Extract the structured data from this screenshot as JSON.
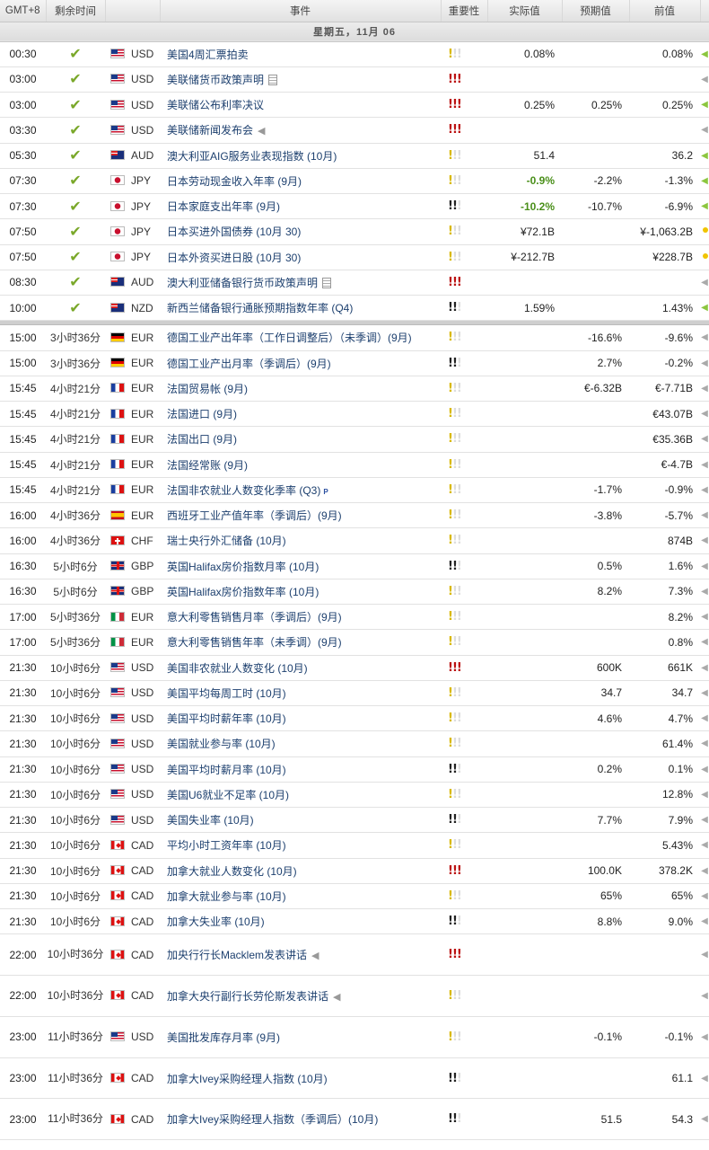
{
  "header": {
    "timezone": "GMT+8",
    "remaining": "剩余时间",
    "event": "事件",
    "importance": "重要性",
    "actual": "实际值",
    "forecast": "预期值",
    "previous": "前值"
  },
  "day_label": "星期五，11月 06",
  "colors": {
    "high": "#b11111",
    "medium": "#e57a00",
    "low": "#d8b800",
    "good": "#4a8f1a"
  },
  "past_events": [
    {
      "time": "00:30",
      "done": true,
      "flag": "us",
      "currency": "USD",
      "name": "美国4周汇票拍卖",
      "icon": "",
      "imp": "low",
      "level": 1,
      "actual": "0.08%",
      "forecast": "",
      "previous": "0.08%",
      "good": false,
      "arrow": "green",
      "dot": false
    },
    {
      "time": "03:00",
      "done": true,
      "flag": "us",
      "currency": "USD",
      "name": "美联储货币政策声明",
      "icon": "doc",
      "imp": "high",
      "level": 3,
      "actual": "",
      "forecast": "",
      "previous": "",
      "good": false,
      "arrow": "gray",
      "dot": false
    },
    {
      "time": "03:00",
      "done": true,
      "flag": "us",
      "currency": "USD",
      "name": "美联储公布利率决议",
      "icon": "",
      "imp": "high",
      "level": 3,
      "actual": "0.25%",
      "forecast": "0.25%",
      "previous": "0.25%",
      "good": false,
      "arrow": "green",
      "dot": false
    },
    {
      "time": "03:30",
      "done": true,
      "flag": "us",
      "currency": "USD",
      "name": "美联储新闻发布会",
      "icon": "mic",
      "imp": "high",
      "level": 3,
      "actual": "",
      "forecast": "",
      "previous": "",
      "good": false,
      "arrow": "gray",
      "dot": false
    },
    {
      "time": "05:30",
      "done": true,
      "flag": "au",
      "currency": "AUD",
      "name": "澳大利亚AIG服务业表现指数 (10月)",
      "icon": "",
      "imp": "low",
      "level": 1,
      "actual": "51.4",
      "forecast": "",
      "previous": "36.2",
      "good": false,
      "arrow": "green",
      "dot": false
    },
    {
      "time": "07:30",
      "done": true,
      "flag": "jp",
      "currency": "JPY",
      "name": "日本劳动现金收入年率 (9月)",
      "icon": "",
      "imp": "low",
      "level": 1,
      "actual": "-0.9%",
      "forecast": "-2.2%",
      "previous": "-1.3%",
      "good": true,
      "arrow": "green",
      "dot": false
    },
    {
      "time": "07:30",
      "done": true,
      "flag": "jp",
      "currency": "JPY",
      "name": "日本家庭支出年率 (9月)",
      "icon": "",
      "imp": "medium",
      "level": 2,
      "actual": "-10.2%",
      "forecast": "-10.7%",
      "previous": "-6.9%",
      "good": true,
      "arrow": "green",
      "dot": false
    },
    {
      "time": "07:50",
      "done": true,
      "flag": "jp",
      "currency": "JPY",
      "name": "日本买进外国债券 (10月 30)",
      "icon": "",
      "imp": "low",
      "level": 1,
      "actual": "¥72.1B",
      "forecast": "",
      "previous": "¥-1,063.2B",
      "good": false,
      "arrow": "none",
      "dot": true
    },
    {
      "time": "07:50",
      "done": true,
      "flag": "jp",
      "currency": "JPY",
      "name": "日本外资买进日股 (10月 30)",
      "icon": "",
      "imp": "low",
      "level": 1,
      "actual": "¥-212.7B",
      "forecast": "",
      "previous": "¥228.7B",
      "good": false,
      "arrow": "none",
      "dot": true
    },
    {
      "time": "08:30",
      "done": true,
      "flag": "au",
      "currency": "AUD",
      "name": "澳大利亚储备银行货币政策声明",
      "icon": "doc",
      "imp": "high",
      "level": 3,
      "actual": "",
      "forecast": "",
      "previous": "",
      "good": false,
      "arrow": "gray",
      "dot": false
    },
    {
      "time": "10:00",
      "done": true,
      "flag": "nz",
      "currency": "NZD",
      "name": "新西兰储备银行通胀预期指数年率 (Q4)",
      "icon": "",
      "imp": "medium",
      "level": 2,
      "actual": "1.59%",
      "forecast": "",
      "previous": "1.43%",
      "good": false,
      "arrow": "green",
      "dot": false
    }
  ],
  "upcoming_events": [
    {
      "time": "15:00",
      "remain": "3小时36分",
      "flag": "de",
      "currency": "EUR",
      "name": "德国工业产出年率（工作日调整后）（未季调）(9月)",
      "icon": "",
      "imp": "low",
      "level": 1,
      "forecast": "-16.6%",
      "previous": "-9.6%",
      "tall": false
    },
    {
      "time": "15:00",
      "remain": "3小时36分",
      "flag": "de",
      "currency": "EUR",
      "name": "德国工业产出月率（季调后）(9月)",
      "icon": "",
      "imp": "medium",
      "level": 2,
      "forecast": "2.7%",
      "previous": "-0.2%",
      "tall": false
    },
    {
      "time": "15:45",
      "remain": "4小时21分",
      "flag": "fr",
      "currency": "EUR",
      "name": "法国贸易帐 (9月)",
      "icon": "",
      "imp": "low",
      "level": 1,
      "forecast": "€-6.32B",
      "previous": "€-7.71B",
      "tall": false
    },
    {
      "time": "15:45",
      "remain": "4小时21分",
      "flag": "fr",
      "currency": "EUR",
      "name": "法国进口 (9月)",
      "icon": "",
      "imp": "low",
      "level": 1,
      "forecast": "",
      "previous": "€43.07B",
      "tall": false
    },
    {
      "time": "15:45",
      "remain": "4小时21分",
      "flag": "fr",
      "currency": "EUR",
      "name": "法国出口 (9月)",
      "icon": "",
      "imp": "low",
      "level": 1,
      "forecast": "",
      "previous": "€35.36B",
      "tall": false
    },
    {
      "time": "15:45",
      "remain": "4小时21分",
      "flag": "fr",
      "currency": "EUR",
      "name": "法国经常账 (9月)",
      "icon": "",
      "imp": "low",
      "level": 1,
      "forecast": "",
      "previous": "€-4.7B",
      "tall": false
    },
    {
      "time": "15:45",
      "remain": "4小时21分",
      "flag": "fr",
      "currency": "EUR",
      "name": "法国非农就业人数变化季率 (Q3)",
      "icon": "p",
      "imp": "low",
      "level": 1,
      "forecast": "-1.7%",
      "previous": "-0.9%",
      "tall": false
    },
    {
      "time": "16:00",
      "remain": "4小时36分",
      "flag": "es",
      "currency": "EUR",
      "name": "西班牙工业产值年率（季调后）(9月)",
      "icon": "",
      "imp": "low",
      "level": 1,
      "forecast": "-3.8%",
      "previous": "-5.7%",
      "tall": false
    },
    {
      "time": "16:00",
      "remain": "4小时36分",
      "flag": "ch",
      "currency": "CHF",
      "name": "瑞士央行外汇储备 (10月)",
      "icon": "",
      "imp": "low",
      "level": 1,
      "forecast": "",
      "previous": "874B",
      "tall": false
    },
    {
      "time": "16:30",
      "remain": "5小时6分",
      "flag": "gb",
      "currency": "GBP",
      "name": "英国Halifax房价指数月率 (10月)",
      "icon": "",
      "imp": "medium",
      "level": 2,
      "forecast": "0.5%",
      "previous": "1.6%",
      "tall": false
    },
    {
      "time": "16:30",
      "remain": "5小时6分",
      "flag": "gb",
      "currency": "GBP",
      "name": "英国Halifax房价指数年率 (10月)",
      "icon": "",
      "imp": "low",
      "level": 1,
      "forecast": "8.2%",
      "previous": "7.3%",
      "tall": false
    },
    {
      "time": "17:00",
      "remain": "5小时36分",
      "flag": "it",
      "currency": "EUR",
      "name": "意大利零售销售月率（季调后）(9月)",
      "icon": "",
      "imp": "low",
      "level": 1,
      "forecast": "",
      "previous": "8.2%",
      "tall": false
    },
    {
      "time": "17:00",
      "remain": "5小时36分",
      "flag": "it",
      "currency": "EUR",
      "name": "意大利零售销售年率（未季调）(9月)",
      "icon": "",
      "imp": "low",
      "level": 1,
      "forecast": "",
      "previous": "0.8%",
      "tall": false
    },
    {
      "time": "21:30",
      "remain": "10小时6分",
      "flag": "us",
      "currency": "USD",
      "name": "美国非农就业人数变化 (10月)",
      "icon": "",
      "imp": "high",
      "level": 3,
      "forecast": "600K",
      "previous": "661K",
      "tall": false
    },
    {
      "time": "21:30",
      "remain": "10小时6分",
      "flag": "us",
      "currency": "USD",
      "name": "美国平均每周工时 (10月)",
      "icon": "",
      "imp": "low",
      "level": 1,
      "forecast": "34.7",
      "previous": "34.7",
      "tall": false
    },
    {
      "time": "21:30",
      "remain": "10小时6分",
      "flag": "us",
      "currency": "USD",
      "name": "美国平均时薪年率 (10月)",
      "icon": "",
      "imp": "low",
      "level": 1,
      "forecast": "4.6%",
      "previous": "4.7%",
      "tall": false
    },
    {
      "time": "21:30",
      "remain": "10小时6分",
      "flag": "us",
      "currency": "USD",
      "name": "美国就业参与率 (10月)",
      "icon": "",
      "imp": "low",
      "level": 1,
      "forecast": "",
      "previous": "61.4%",
      "tall": false
    },
    {
      "time": "21:30",
      "remain": "10小时6分",
      "flag": "us",
      "currency": "USD",
      "name": "美国平均时薪月率 (10月)",
      "icon": "",
      "imp": "medium",
      "level": 2,
      "forecast": "0.2%",
      "previous": "0.1%",
      "tall": false
    },
    {
      "time": "21:30",
      "remain": "10小时6分",
      "flag": "us",
      "currency": "USD",
      "name": "美国U6就业不足率 (10月)",
      "icon": "",
      "imp": "low",
      "level": 1,
      "forecast": "",
      "previous": "12.8%",
      "tall": false
    },
    {
      "time": "21:30",
      "remain": "10小时6分",
      "flag": "us",
      "currency": "USD",
      "name": "美国失业率 (10月)",
      "icon": "",
      "imp": "medium",
      "level": 2,
      "forecast": "7.7%",
      "previous": "7.9%",
      "tall": false
    },
    {
      "time": "21:30",
      "remain": "10小时6分",
      "flag": "ca",
      "currency": "CAD",
      "name": "平均小时工资年率 (10月)",
      "icon": "",
      "imp": "low",
      "level": 1,
      "forecast": "",
      "previous": "5.43%",
      "tall": false
    },
    {
      "time": "21:30",
      "remain": "10小时6分",
      "flag": "ca",
      "currency": "CAD",
      "name": "加拿大就业人数变化 (10月)",
      "icon": "",
      "imp": "high",
      "level": 3,
      "forecast": "100.0K",
      "previous": "378.2K",
      "tall": false
    },
    {
      "time": "21:30",
      "remain": "10小时6分",
      "flag": "ca",
      "currency": "CAD",
      "name": "加拿大就业参与率 (10月)",
      "icon": "",
      "imp": "low",
      "level": 1,
      "forecast": "65%",
      "previous": "65%",
      "tall": false
    },
    {
      "time": "21:30",
      "remain": "10小时6分",
      "flag": "ca",
      "currency": "CAD",
      "name": "加拿大失业率 (10月)",
      "icon": "",
      "imp": "medium",
      "level": 2,
      "forecast": "8.8%",
      "previous": "9.0%",
      "tall": false
    },
    {
      "time": "22:00",
      "remain": "10小时36分",
      "flag": "ca",
      "currency": "CAD",
      "name": "加央行行长Macklem发表讲话",
      "icon": "mic",
      "imp": "high",
      "level": 3,
      "forecast": "",
      "previous": "",
      "tall": true
    },
    {
      "time": "22:00",
      "remain": "10小时36分",
      "flag": "ca",
      "currency": "CAD",
      "name": "加拿大央行副行长劳伦斯发表讲话",
      "icon": "mic",
      "imp": "low",
      "level": 1,
      "forecast": "",
      "previous": "",
      "tall": true
    },
    {
      "time": "23:00",
      "remain": "11小时36分",
      "flag": "us",
      "currency": "USD",
      "name": "美国批发库存月率 (9月)",
      "icon": "",
      "imp": "low",
      "level": 1,
      "forecast": "-0.1%",
      "previous": "-0.1%",
      "tall": true
    },
    {
      "time": "23:00",
      "remain": "11小时36分",
      "flag": "ca",
      "currency": "CAD",
      "name": "加拿大Ivey采购经理人指数 (10月)",
      "icon": "",
      "imp": "medium",
      "level": 2,
      "forecast": "",
      "previous": "61.1",
      "tall": true
    },
    {
      "time": "23:00",
      "remain": "11小时36分",
      "flag": "ca",
      "currency": "CAD",
      "name": "加拿大Ivey采购经理人指数（季调后）(10月)",
      "icon": "",
      "imp": "medium",
      "level": 2,
      "forecast": "51.5",
      "previous": "54.3",
      "tall": true
    }
  ]
}
